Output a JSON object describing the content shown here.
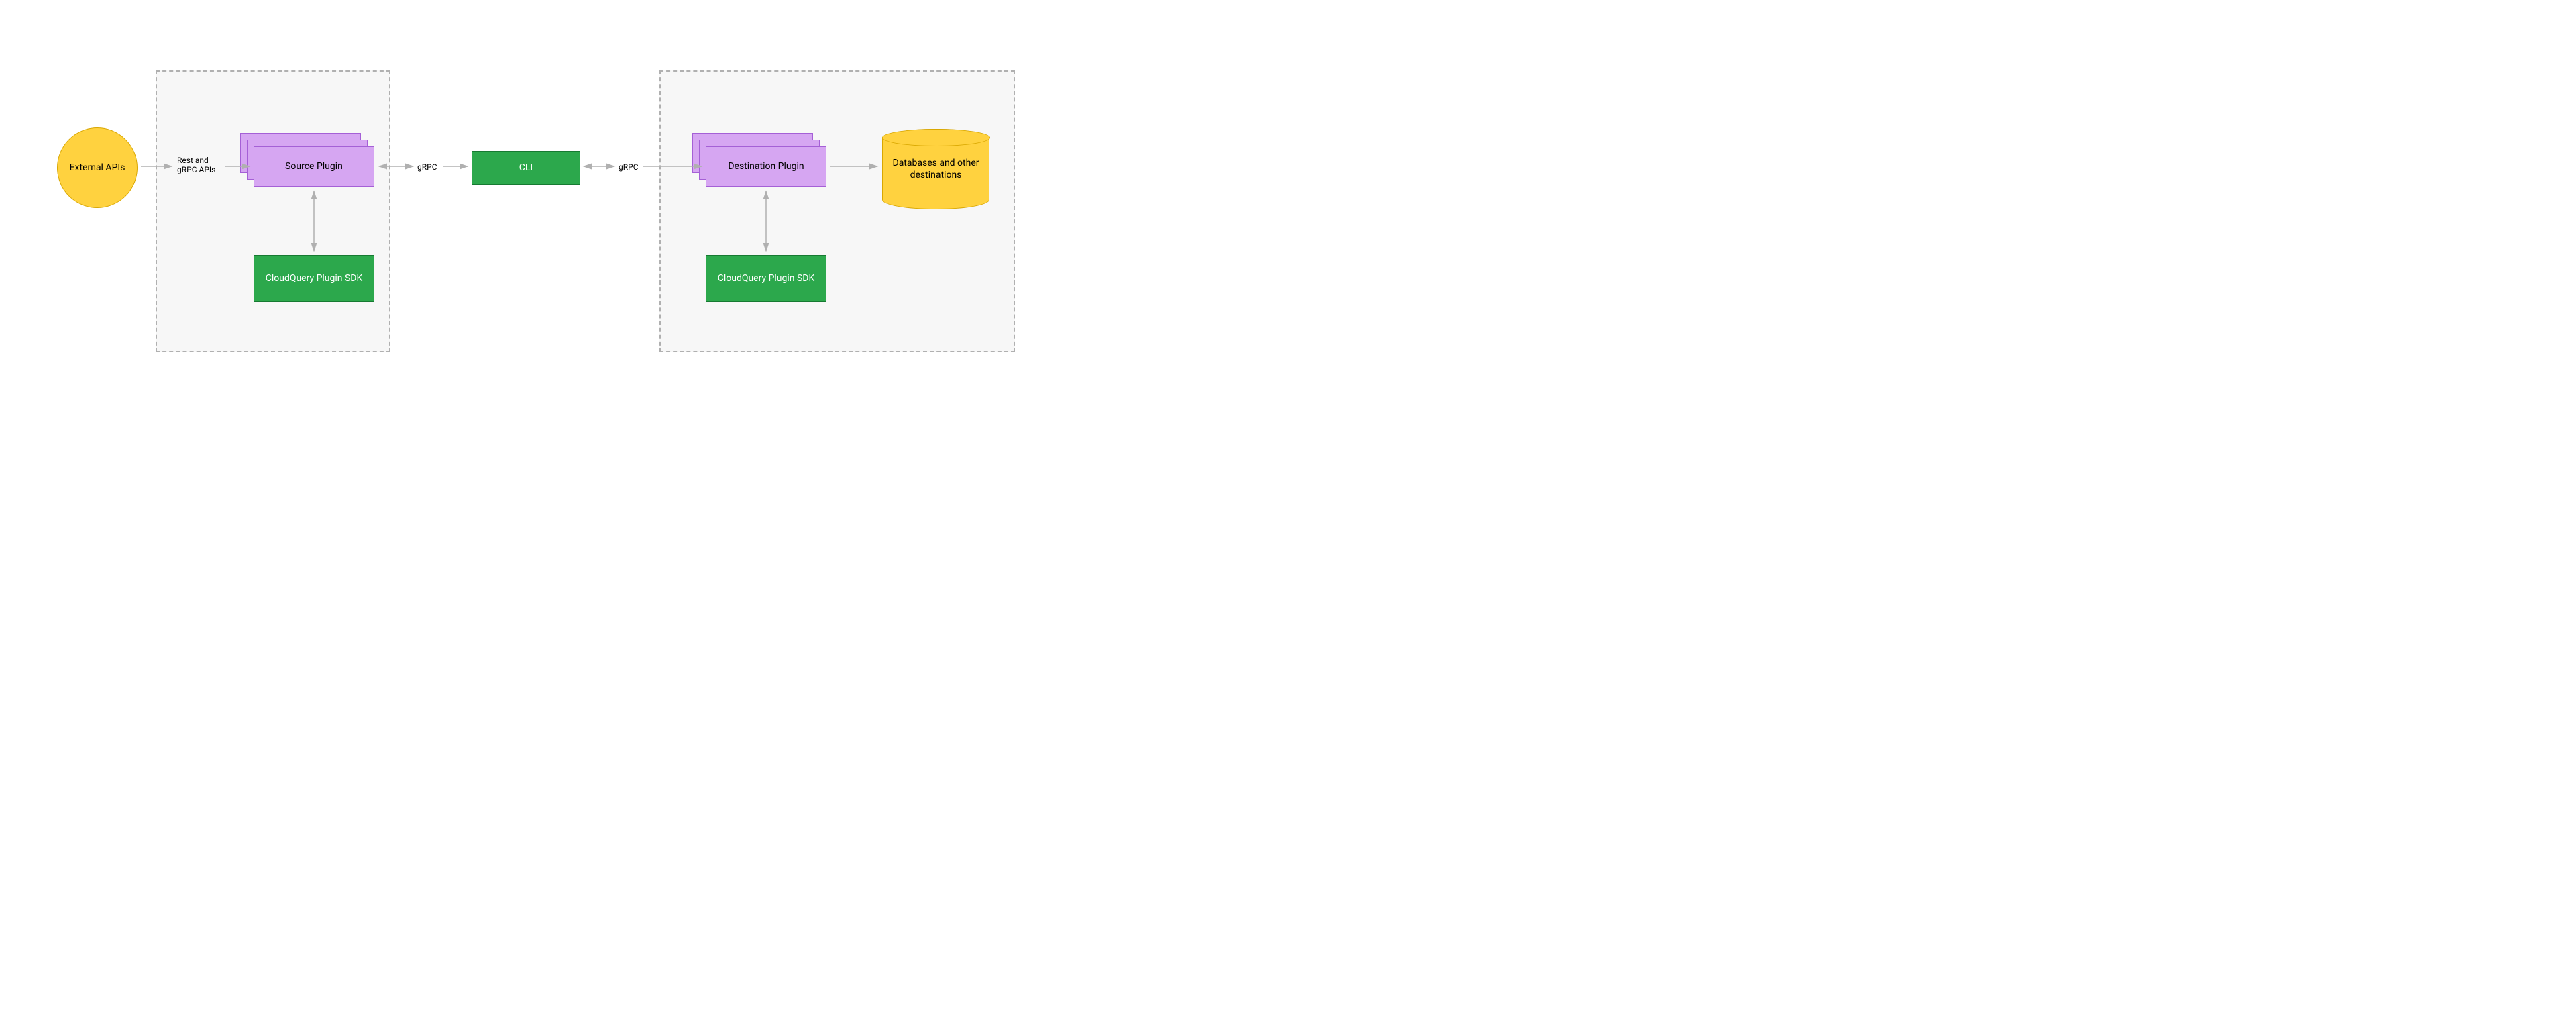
{
  "nodes": {
    "external_apis": "External APIs",
    "source_plugin": "Source Plugin",
    "source_sdk": "CloudQuery Plugin SDK",
    "cli": "CLI",
    "dest_plugin": "Destination Plugin",
    "dest_sdk": "CloudQuery Plugin SDK",
    "databases": "Databases and other destinations"
  },
  "edges": {
    "rest_grpc": "Rest and gRPC APIs",
    "grpc_left": "gRPC",
    "grpc_right": "gRPC"
  },
  "colors": {
    "yellow": "#ffd23f",
    "green": "#2ca84c",
    "purple": "#d6a6f2",
    "arrow": "#b0b0b0",
    "dashed": "#b0b0b0"
  }
}
